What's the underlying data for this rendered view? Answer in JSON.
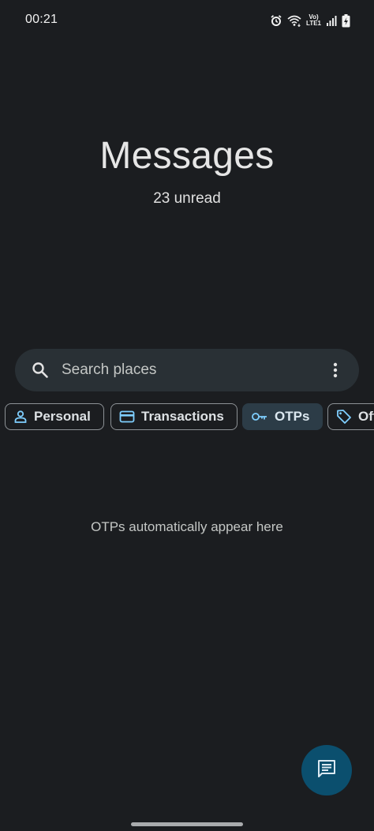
{
  "status_bar": {
    "time": "00:21",
    "icons": [
      "alarm-icon",
      "wifi-icon",
      "volte-icon",
      "signal-icon",
      "battery-icon"
    ],
    "volte_line1": "Vo)",
    "volte_line2": "LTE1"
  },
  "header": {
    "title": "Messages",
    "subtitle": "23 unread"
  },
  "search": {
    "placeholder": "Search places",
    "icon": "search-icon",
    "menu_icon": "more-vert-icon"
  },
  "chips": [
    {
      "label": "Personal",
      "icon": "person-icon",
      "selected": false
    },
    {
      "label": "Transactions",
      "icon": "card-icon",
      "selected": false
    },
    {
      "label": "OTPs",
      "icon": "key-icon",
      "selected": true
    },
    {
      "label": "Offers",
      "icon": "tag-icon",
      "selected": false
    }
  ],
  "empty_state": {
    "text": "OTPs automatically appear here"
  },
  "fab": {
    "icon": "chat-compose-icon"
  },
  "colors": {
    "background": "#1b1d20",
    "search_bg": "#293035",
    "chip_selected_bg": "#2c3c47",
    "accent": "#7fcfff",
    "fab_bg": "#0b4f6e"
  }
}
